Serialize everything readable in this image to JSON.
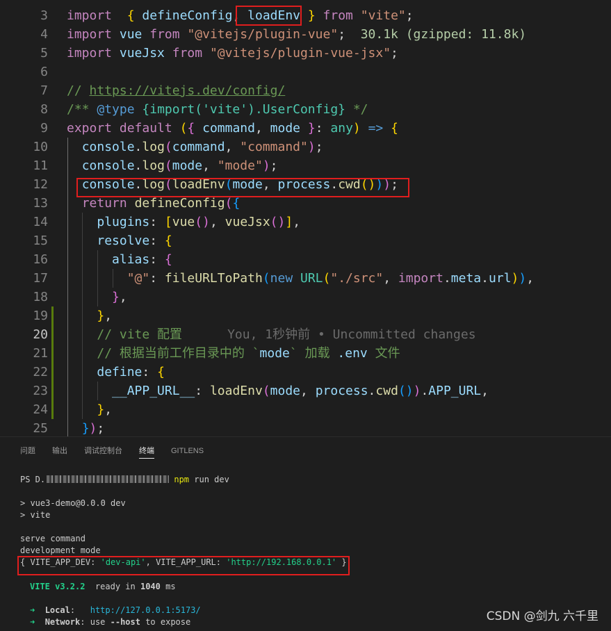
{
  "editor": {
    "lines": [
      {
        "n": "3",
        "parts": [
          [
            "k",
            "import"
          ],
          [
            "",
            "  "
          ],
          [
            "y",
            "{"
          ],
          [
            "",
            " "
          ],
          [
            "v",
            "defineConfig"
          ],
          [
            "",
            ", "
          ],
          [
            "v",
            "loadEnv"
          ],
          [
            "",
            " "
          ],
          [
            "y",
            "}"
          ],
          [
            "",
            " "
          ],
          [
            "k",
            "from"
          ],
          [
            "",
            " "
          ],
          [
            "s",
            "\"vite\""
          ],
          [
            "",
            ";"
          ]
        ]
      },
      {
        "n": "4",
        "parts": [
          [
            "k",
            "import"
          ],
          [
            "",
            " "
          ],
          [
            "v",
            "vue"
          ],
          [
            "",
            " "
          ],
          [
            "k",
            "from"
          ],
          [
            "",
            " "
          ],
          [
            "s",
            "\"@vitejs/plugin-vue\""
          ],
          [
            "",
            ";  "
          ],
          [
            "n",
            "30.1k (gzipped: 11.8k)"
          ]
        ]
      },
      {
        "n": "5",
        "parts": [
          [
            "k",
            "import"
          ],
          [
            "",
            " "
          ],
          [
            "v",
            "vueJsx"
          ],
          [
            "",
            " "
          ],
          [
            "k",
            "from"
          ],
          [
            "",
            " "
          ],
          [
            "s",
            "\"@vitejs/plugin-vue-jsx\""
          ],
          [
            "",
            ";"
          ]
        ]
      },
      {
        "n": "6",
        "parts": []
      },
      {
        "n": "7",
        "parts": [
          [
            "c",
            "// "
          ],
          [
            "cu",
            "https://vitejs.dev/config/"
          ]
        ]
      },
      {
        "n": "8",
        "parts": [
          [
            "c",
            "/** "
          ],
          [
            "kw",
            "@type"
          ],
          [
            "c",
            " "
          ],
          [
            "t",
            "{import('vite').UserConfig}"
          ],
          [
            "c",
            " */"
          ]
        ]
      },
      {
        "n": "9",
        "parts": [
          [
            "k",
            "export"
          ],
          [
            "",
            " "
          ],
          [
            "k",
            "default"
          ],
          [
            "",
            " "
          ],
          [
            "y",
            "("
          ],
          [
            "p",
            "{"
          ],
          [
            "",
            " "
          ],
          [
            "v",
            "command"
          ],
          [
            "",
            ", "
          ],
          [
            "v",
            "mode"
          ],
          [
            "",
            " "
          ],
          [
            "p",
            "}"
          ],
          [
            "",
            ": "
          ],
          [
            "t",
            "any"
          ],
          [
            "y",
            ")"
          ],
          [
            "",
            " "
          ],
          [
            "kw",
            "=>"
          ],
          [
            "",
            " "
          ],
          [
            "y",
            "{"
          ]
        ]
      },
      {
        "n": "10",
        "parts": [
          [
            "",
            "  "
          ],
          [
            "v",
            "console"
          ],
          [
            "",
            "."
          ],
          [
            "f",
            "log"
          ],
          [
            "p",
            "("
          ],
          [
            "v",
            "command"
          ],
          [
            "",
            ", "
          ],
          [
            "s",
            "\"command\""
          ],
          [
            "p",
            ")"
          ],
          [
            "",
            ";"
          ]
        ]
      },
      {
        "n": "11",
        "parts": [
          [
            "",
            "  "
          ],
          [
            "v",
            "console"
          ],
          [
            "",
            "."
          ],
          [
            "f",
            "log"
          ],
          [
            "p",
            "("
          ],
          [
            "v",
            "mode"
          ],
          [
            "",
            ", "
          ],
          [
            "s",
            "\"mode\""
          ],
          [
            "p",
            ")"
          ],
          [
            "",
            ";"
          ]
        ]
      },
      {
        "n": "12",
        "parts": [
          [
            "",
            "  "
          ],
          [
            "v",
            "console"
          ],
          [
            "",
            "."
          ],
          [
            "f",
            "log"
          ],
          [
            "p",
            "("
          ],
          [
            "f",
            "loadEnv"
          ],
          [
            "b",
            "("
          ],
          [
            "v",
            "mode"
          ],
          [
            "",
            ", "
          ],
          [
            "v",
            "process"
          ],
          [
            "",
            "."
          ],
          [
            "f",
            "cwd"
          ],
          [
            "y",
            "()"
          ],
          [
            "b",
            ")"
          ],
          [
            "p",
            ")"
          ],
          [
            "",
            ";"
          ]
        ]
      },
      {
        "n": "13",
        "parts": [
          [
            "",
            "  "
          ],
          [
            "k",
            "return"
          ],
          [
            "",
            " "
          ],
          [
            "f",
            "defineConfig"
          ],
          [
            "p",
            "("
          ],
          [
            "b",
            "{"
          ]
        ]
      },
      {
        "n": "14",
        "parts": [
          [
            "",
            "    "
          ],
          [
            "v",
            "plugins"
          ],
          [
            "",
            ": "
          ],
          [
            "y",
            "["
          ],
          [
            "f",
            "vue"
          ],
          [
            "p",
            "()"
          ],
          [
            "",
            ", "
          ],
          [
            "f",
            "vueJsx"
          ],
          [
            "p",
            "()"
          ],
          [
            "y",
            "]"
          ],
          [
            "",
            ","
          ]
        ]
      },
      {
        "n": "15",
        "parts": [
          [
            "",
            "    "
          ],
          [
            "v",
            "resolve"
          ],
          [
            "",
            ": "
          ],
          [
            "y",
            "{"
          ]
        ]
      },
      {
        "n": "16",
        "parts": [
          [
            "",
            "      "
          ],
          [
            "v",
            "alias"
          ],
          [
            "",
            ": "
          ],
          [
            "p",
            "{"
          ]
        ]
      },
      {
        "n": "17",
        "parts": [
          [
            "",
            "        "
          ],
          [
            "s",
            "\"@\""
          ],
          [
            "",
            ": "
          ],
          [
            "f",
            "fileURLToPath"
          ],
          [
            "b",
            "("
          ],
          [
            "kw",
            "new"
          ],
          [
            "",
            " "
          ],
          [
            "t",
            "URL"
          ],
          [
            "y",
            "("
          ],
          [
            "s",
            "\"./src\""
          ],
          [
            "",
            ", "
          ],
          [
            "k",
            "import"
          ],
          [
            "",
            "."
          ],
          [
            "v",
            "meta"
          ],
          [
            "",
            "."
          ],
          [
            "v",
            "url"
          ],
          [
            "y",
            ")"
          ],
          [
            "b",
            ")"
          ],
          [
            "",
            ","
          ]
        ]
      },
      {
        "n": "18",
        "parts": [
          [
            "",
            "      "
          ],
          [
            "p",
            "}"
          ],
          [
            "",
            ","
          ]
        ]
      },
      {
        "n": "19",
        "parts": [
          [
            "",
            "    "
          ],
          [
            "y",
            "}"
          ],
          [
            "",
            ","
          ]
        ]
      },
      {
        "n": "20",
        "parts": [
          [
            "",
            "    "
          ],
          [
            "c",
            "// vite 配置"
          ],
          [
            "",
            "      "
          ],
          [
            "bl",
            "You, 1秒钟前 • Uncommitted changes"
          ]
        ]
      },
      {
        "n": "21",
        "parts": [
          [
            "",
            "    "
          ],
          [
            "c",
            "// 根据当前工作目录中的 `"
          ],
          [
            "v",
            "mode"
          ],
          [
            "c",
            "` 加载 "
          ],
          [
            "v",
            ".env"
          ],
          [
            "c",
            " 文件"
          ]
        ]
      },
      {
        "n": "22",
        "parts": [
          [
            "",
            "    "
          ],
          [
            "v",
            "define"
          ],
          [
            "",
            ": "
          ],
          [
            "y",
            "{"
          ]
        ]
      },
      {
        "n": "23",
        "parts": [
          [
            "",
            "      "
          ],
          [
            "v",
            "__APP_URL__"
          ],
          [
            "",
            ": "
          ],
          [
            "f",
            "loadEnv"
          ],
          [
            "p",
            "("
          ],
          [
            "v",
            "mode"
          ],
          [
            "",
            ", "
          ],
          [
            "v",
            "process"
          ],
          [
            "",
            "."
          ],
          [
            "f",
            "cwd"
          ],
          [
            "b",
            "()"
          ],
          [
            "p",
            ")"
          ],
          [
            "",
            "."
          ],
          [
            "v",
            "APP_URL"
          ],
          [
            "",
            ","
          ]
        ]
      },
      {
        "n": "24",
        "parts": [
          [
            "",
            "    "
          ],
          [
            "y",
            "}"
          ],
          [
            "",
            ","
          ]
        ]
      },
      {
        "n": "25",
        "parts": [
          [
            "",
            "  "
          ],
          [
            "b",
            "}"
          ],
          [
            "p",
            ")"
          ],
          [
            "",
            ";"
          ]
        ]
      }
    ]
  },
  "panel": {
    "tabs": [
      "问题",
      "输出",
      "调试控制台",
      "终端",
      "GITLENS"
    ],
    "active_tab": "终端",
    "prompt_prefix": "PS D.",
    "prompt_cmd": "npm",
    "prompt_args": " run dev",
    "out1": "> vue3-demo@0.0.0 dev",
    "out2": "> vite",
    "out3": "serve command",
    "out4": "development mode",
    "env_open": "{ VITE_APP_DEV: ",
    "env_dev": "'dev-api'",
    "env_mid": ", VITE_APP_URL: ",
    "env_url": "'http://192.168.0.0.1'",
    "env_close": " }",
    "vite_name": "VITE v3.2.2",
    "ready_pre": "  ready in ",
    "ready_ms": "1040",
    "ready_post": " ms",
    "arrow": "➜",
    "local_label": "Local",
    "local_sep": ":   ",
    "local_url": "http://127.0.0.1:5173/",
    "network_label": "Network",
    "network_pre": ": use ",
    "network_flag": "--host",
    "network_post": " to expose"
  },
  "watermark": "CSDN @剑九 六千里",
  "colors": {
    "highlight_box": "#e01e1e",
    "terminal_green": "#23d18b",
    "terminal_cyan": "#29b8db"
  }
}
